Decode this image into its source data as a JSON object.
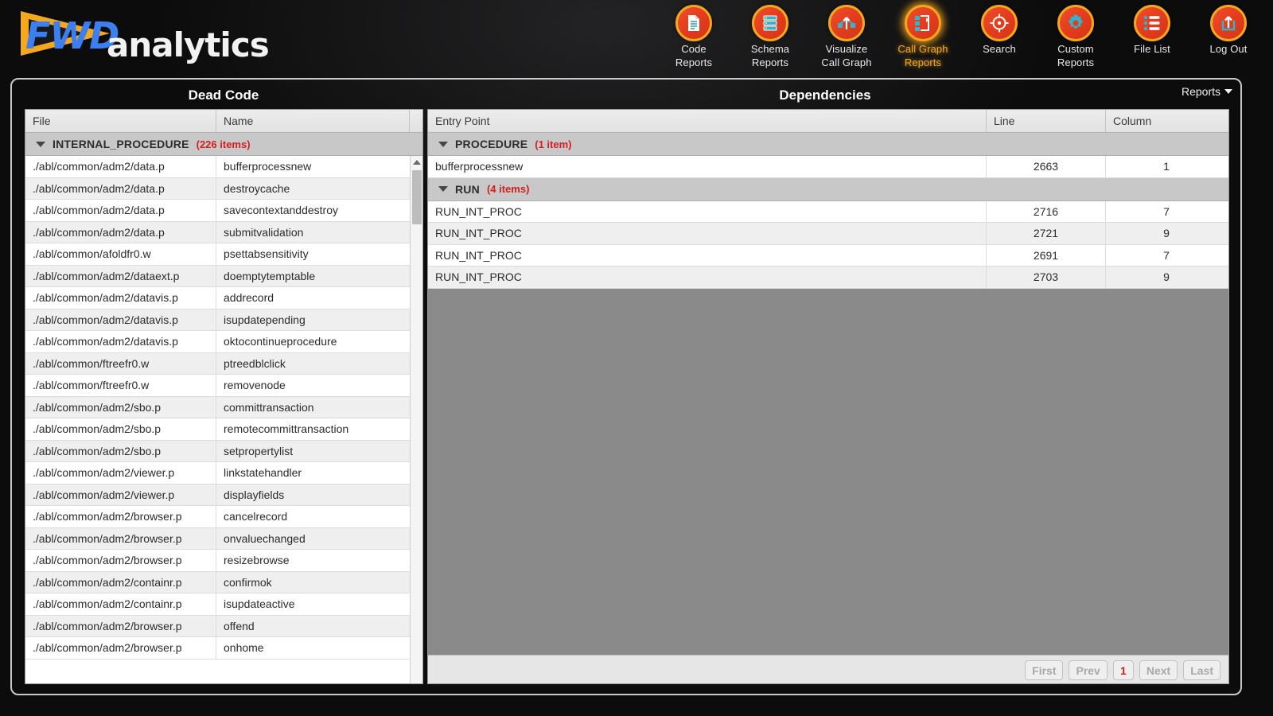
{
  "brand": {
    "mark": "FWD",
    "word": "analytics"
  },
  "nav": {
    "items": [
      {
        "label_line1": "Code",
        "label_line2": "Reports",
        "icon": "document-icon",
        "active": false
      },
      {
        "label_line1": "Schema",
        "label_line2": "Reports",
        "icon": "database-icon",
        "active": false
      },
      {
        "label_line1": "Visualize",
        "label_line2": "Call Graph",
        "icon": "call-graph-icon",
        "active": false
      },
      {
        "label_line1": "Call Graph",
        "label_line2": "Reports",
        "icon": "graph-report-icon",
        "active": true
      },
      {
        "label_line1": "Search",
        "label_line2": "",
        "icon": "target-icon",
        "active": false
      },
      {
        "label_line1": "Custom",
        "label_line2": "Reports",
        "icon": "gear-icon",
        "active": false
      },
      {
        "label_line1": "File List",
        "label_line2": "",
        "icon": "list-icon",
        "active": false
      },
      {
        "label_line1": "Log Out",
        "label_line2": "",
        "icon": "logout-icon",
        "active": false
      }
    ]
  },
  "reports_menu": {
    "label": "Reports"
  },
  "left_panel": {
    "title": "Dead Code",
    "columns": [
      "File",
      "Name"
    ],
    "group": {
      "label": "INTERNAL_PROCEDURE",
      "count": "(226 items)"
    },
    "rows": [
      {
        "file": "./abl/common/adm2/data.p",
        "name": "bufferprocessnew"
      },
      {
        "file": "./abl/common/adm2/data.p",
        "name": "destroycache"
      },
      {
        "file": "./abl/common/adm2/data.p",
        "name": "savecontextanddestroy"
      },
      {
        "file": "./abl/common/adm2/data.p",
        "name": "submitvalidation"
      },
      {
        "file": "./abl/common/afoldfr0.w",
        "name": "psettabsensitivity"
      },
      {
        "file": "./abl/common/adm2/dataext.p",
        "name": "doemptytemptable"
      },
      {
        "file": "./abl/common/adm2/datavis.p",
        "name": "addrecord"
      },
      {
        "file": "./abl/common/adm2/datavis.p",
        "name": "isupdatepending"
      },
      {
        "file": "./abl/common/adm2/datavis.p",
        "name": "oktocontinueprocedure"
      },
      {
        "file": "./abl/common/ftreefr0.w",
        "name": "ptreedblclick"
      },
      {
        "file": "./abl/common/ftreefr0.w",
        "name": "removenode"
      },
      {
        "file": "./abl/common/adm2/sbo.p",
        "name": "committransaction"
      },
      {
        "file": "./abl/common/adm2/sbo.p",
        "name": "remotecommittransaction"
      },
      {
        "file": "./abl/common/adm2/sbo.p",
        "name": "setpropertylist"
      },
      {
        "file": "./abl/common/adm2/viewer.p",
        "name": "linkstatehandler"
      },
      {
        "file": "./abl/common/adm2/viewer.p",
        "name": "displayfields"
      },
      {
        "file": "./abl/common/adm2/browser.p",
        "name": "cancelrecord"
      },
      {
        "file": "./abl/common/adm2/browser.p",
        "name": "onvaluechanged"
      },
      {
        "file": "./abl/common/adm2/browser.p",
        "name": "resizebrowse"
      },
      {
        "file": "./abl/common/adm2/containr.p",
        "name": "confirmok"
      },
      {
        "file": "./abl/common/adm2/containr.p",
        "name": "isupdateactive"
      },
      {
        "file": "./abl/common/adm2/browser.p",
        "name": "offend"
      },
      {
        "file": "./abl/common/adm2/browser.p",
        "name": "onhome"
      }
    ]
  },
  "right_panel": {
    "title": "Dependencies",
    "columns": [
      "Entry Point",
      "Line",
      "Column"
    ],
    "groups": [
      {
        "label": "PROCEDURE",
        "count": "(1 item)",
        "rows": [
          {
            "entry": "bufferprocessnew",
            "line": "2663",
            "column": "1"
          }
        ]
      },
      {
        "label": "RUN",
        "count": "(4 items)",
        "rows": [
          {
            "entry": "RUN_INT_PROC",
            "line": "2716",
            "column": "7"
          },
          {
            "entry": "RUN_INT_PROC",
            "line": "2721",
            "column": "9"
          },
          {
            "entry": "RUN_INT_PROC",
            "line": "2691",
            "column": "7"
          },
          {
            "entry": "RUN_INT_PROC",
            "line": "2703",
            "column": "9"
          }
        ]
      }
    ],
    "pager": {
      "first": "First",
      "prev": "Prev",
      "current": "1",
      "next": "Next",
      "last": "Last"
    }
  },
  "colors": {
    "accent_orange": "#f5a81c",
    "icon_red": "#e23b1d",
    "count_red": "#d21f1f",
    "logo_blue": "#3b7ff0"
  }
}
